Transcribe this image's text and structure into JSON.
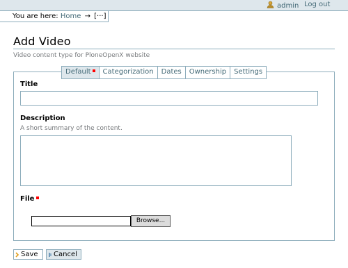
{
  "personal_bar": {
    "user_label": "admin",
    "logout_label": "Log out"
  },
  "breadcrumb": {
    "prefix": "You are here:",
    "home_label": "Home",
    "separator": "→",
    "current": "[···]"
  },
  "page": {
    "title": "Add Video",
    "description": "Video content type for PloneOpenX website"
  },
  "tabs": [
    {
      "label": "Default",
      "required_marker": true,
      "selected": true
    },
    {
      "label": "Categorization"
    },
    {
      "label": "Dates"
    },
    {
      "label": "Ownership"
    },
    {
      "label": "Settings"
    }
  ],
  "fields": {
    "title": {
      "label": "Title",
      "value": ""
    },
    "description": {
      "label": "Description",
      "help": "A short summary of the content.",
      "value": ""
    },
    "file": {
      "label": "File",
      "required": true,
      "browse_label": "Browse..."
    }
  },
  "actions": {
    "save_label": "Save",
    "cancel_label": "Cancel"
  },
  "colors": {
    "accent": "#436976",
    "border": "#8cacbb",
    "tab_bg": "#dee7ec",
    "required": "#ff0000"
  }
}
